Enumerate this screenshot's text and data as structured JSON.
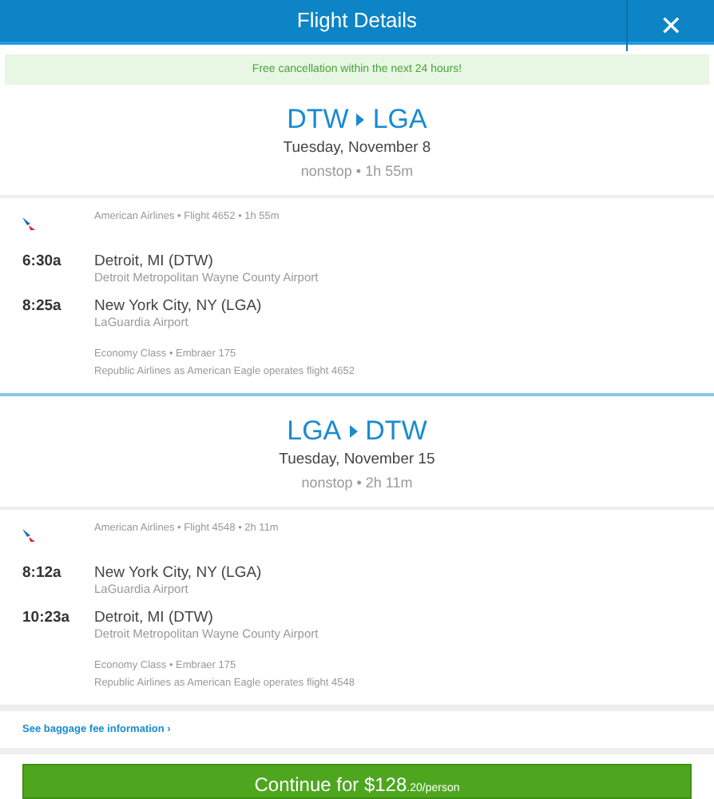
{
  "header": {
    "title": "Flight Details",
    "close": "✕"
  },
  "notice": "Free cancellation within the next 24 hours!",
  "legs": [
    {
      "origin": "DTW",
      "destination": "LGA",
      "date": "Tuesday, November 8",
      "summary": "nonstop • 1h 55m",
      "flight_info": "American Airlines • Flight 4652 • 1h 55m",
      "stops": [
        {
          "time": "6:30a",
          "city": "Detroit, MI (DTW)",
          "airport": "Detroit Metropolitan Wayne County Airport"
        },
        {
          "time": "8:25a",
          "city": "New York City, NY (LGA)",
          "airport": "LaGuardia Airport"
        }
      ],
      "cabin": "Economy Class • Embraer 175",
      "operator": "Republic Airlines as American Eagle operates flight 4652"
    },
    {
      "origin": "LGA",
      "destination": "DTW",
      "date": "Tuesday, November 15",
      "summary": "nonstop • 2h 11m",
      "flight_info": "American Airlines • Flight 4548 • 2h 11m",
      "stops": [
        {
          "time": "8:12a",
          "city": "New York City, NY (LGA)",
          "airport": "LaGuardia Airport"
        },
        {
          "time": "10:23a",
          "city": "Detroit, MI (DTW)",
          "airport": "Detroit Metropolitan Wayne County Airport"
        }
      ],
      "cabin": "Economy Class • Embraer 175",
      "operator": "Republic Airlines as American Eagle operates flight 4548"
    }
  ],
  "baggage_link": "See baggage fee information ›",
  "continue_button": {
    "label": "Continue for $128",
    "suffix": ".20/person"
  }
}
